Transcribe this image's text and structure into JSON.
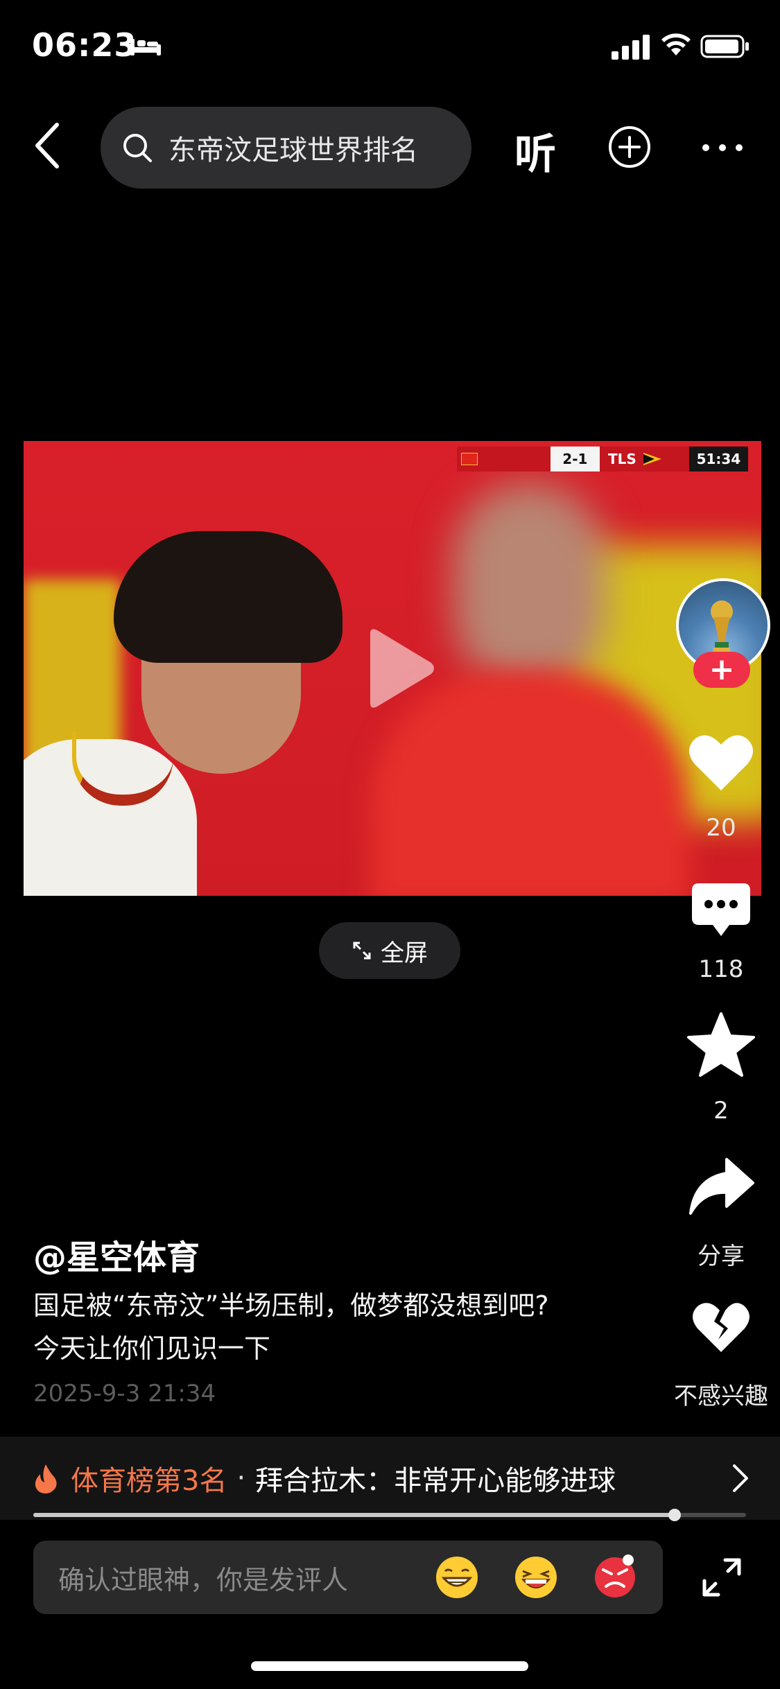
{
  "status_bar": {
    "time": "06:23"
  },
  "top_nav": {
    "search_text": "东帝汶足球世界排名",
    "listen_label": "听"
  },
  "video": {
    "scoreboard": {
      "score": "2-1",
      "team2": "TLS",
      "clock": "51:34"
    },
    "fullscreen_label": "全屏",
    "progress_fraction": 0.9
  },
  "actions": {
    "follow_label": "+",
    "like_count": "20",
    "comment_count": "118",
    "favorite_count": "2",
    "share_label": "分享",
    "dislike_label": "不感兴趣"
  },
  "post": {
    "author": "@星空体育",
    "caption_line1": "国足被“东帝汶”半场压制，做梦都没想到吧?",
    "caption_line2": "今天让你们见识一下",
    "timestamp": "2025-9-3 21:34"
  },
  "ranking": {
    "label": "体育榜第3名",
    "separator": "·",
    "text": "拜合拉木：非常开心能够进球"
  },
  "comment_bar": {
    "placeholder": "确认过眼神，你是发评人",
    "emojis": [
      "grin-emoji",
      "laugh-emoji",
      "angry-emoji"
    ]
  },
  "colors": {
    "background": "#000000",
    "accent_red": "#f03048",
    "rank_orange": "#f5774a"
  }
}
